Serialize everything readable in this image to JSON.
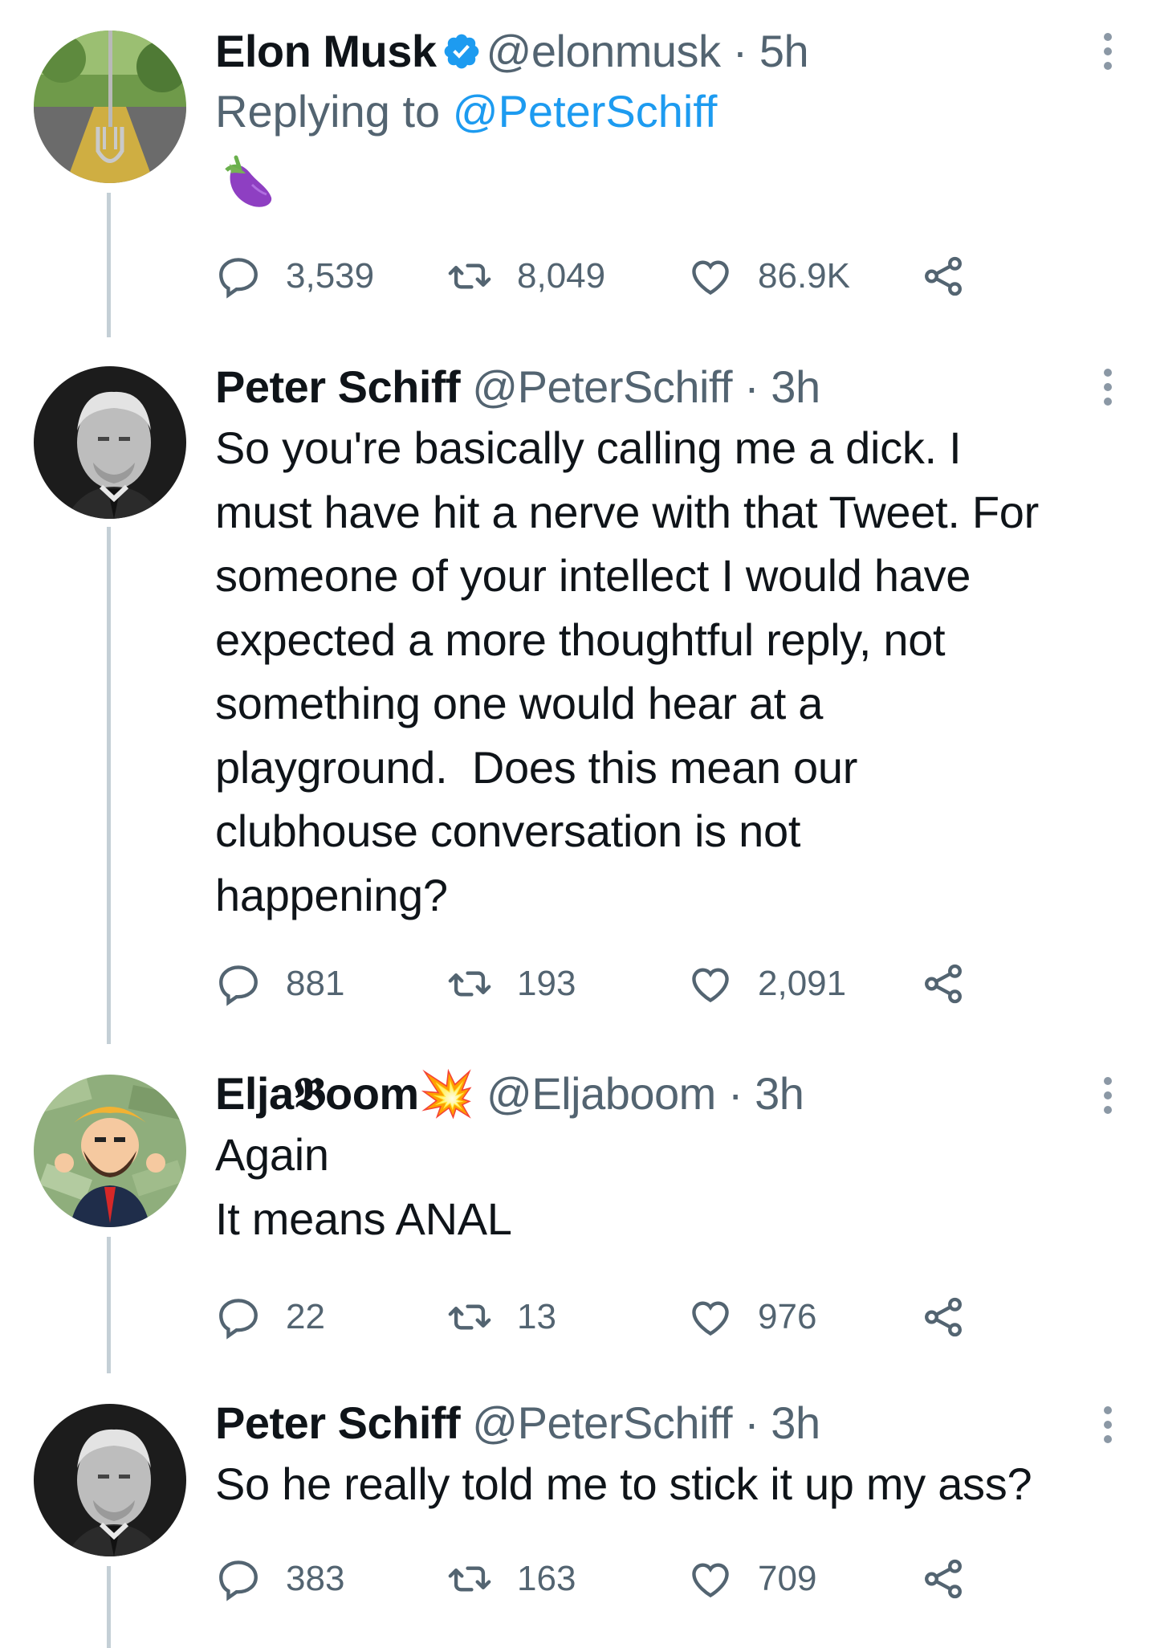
{
  "tweets": [
    {
      "display_name": "Elon Musk",
      "verified": true,
      "handle": "@elonmusk",
      "dot": "·",
      "time": "5h",
      "replying_prefix": "Replying to ",
      "replying_to": "@PeterSchiff",
      "text": "",
      "emoji": "eggplant",
      "avatar_icon": "fork-in-road-avatar",
      "replies": "3,539",
      "retweets": "8,049",
      "likes": "86.9K"
    },
    {
      "display_name": "Peter Schiff",
      "verified": false,
      "handle": "@PeterSchiff",
      "dot": "·",
      "time": "3h",
      "text": "So you're basically calling me a dick. I\nmust have hit a nerve with that Tweet. For\nsomeone of your intellect I would have\nexpected a more thoughtful reply, not\nsomething one would hear at a\nplayground.  Does this mean our\nclubhouse conversation is not\nhappening?",
      "avatar_icon": "man-portrait-avatar",
      "replies": "881",
      "retweets": "193",
      "likes": "2,091"
    },
    {
      "display_name": "Elja𝕭oom💥",
      "verified": false,
      "handle": "@Eljaboom",
      "dot": "·",
      "time": "3h",
      "text": "Again\nIt means ANAL",
      "avatar_icon": "cartoon-money-avatar",
      "replies": "22",
      "retweets": "13",
      "likes": "976"
    },
    {
      "display_name": "Peter Schiff",
      "verified": false,
      "handle": "@PeterSchiff",
      "dot": "·",
      "time": "3h",
      "text": "So he really told me to stick it up my ass?",
      "avatar_icon": "man-portrait-avatar",
      "replies": "383",
      "retweets": "163",
      "likes": "709"
    }
  ],
  "icons": {
    "reply": "reply-icon",
    "retweet": "retweet-icon",
    "like": "like-icon",
    "share": "share-icon",
    "more": "more-options-icon"
  },
  "colors": {
    "text": "#0f1419",
    "secondary": "#536471",
    "link": "#1d9bf0",
    "verified": "#1d9bf0",
    "thread_line": "#c4cfd6"
  }
}
